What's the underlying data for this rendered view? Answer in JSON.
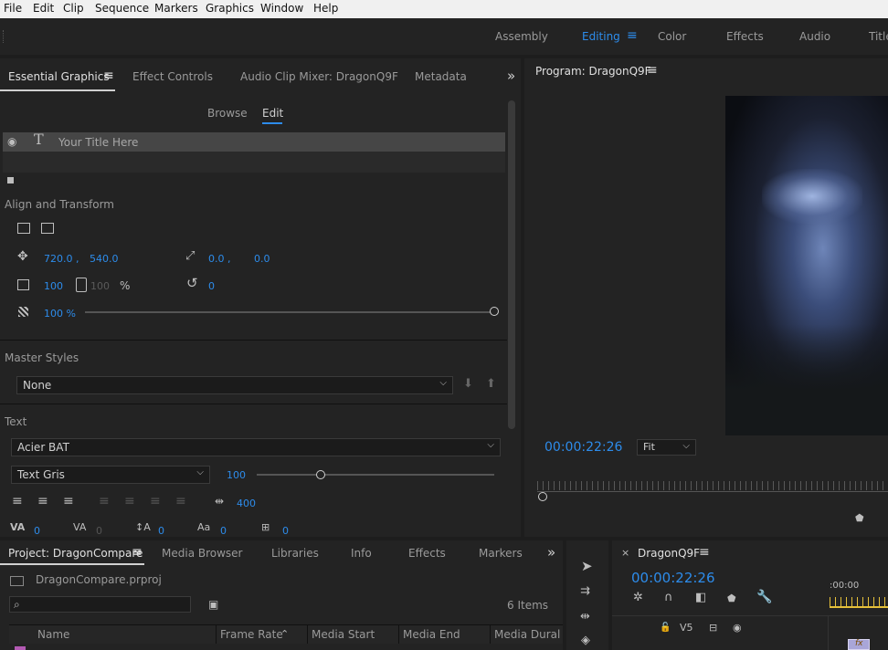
{
  "menu": [
    "File",
    "Edit",
    "Clip",
    "Sequence",
    "Markers",
    "Graphics",
    "Window",
    "Help"
  ],
  "workspaces": {
    "items": [
      "Assembly",
      "Editing",
      "Color",
      "Effects",
      "Audio",
      "Titles"
    ],
    "active": "Editing"
  },
  "left_panel": {
    "tabs": [
      "Essential Graphics",
      "Effect Controls",
      "Audio Clip Mixer: DragonQ9F",
      "Metadata"
    ],
    "subtabs": [
      "Browse",
      "Edit"
    ],
    "layer_name": "Your Title Here",
    "align_section": "Align and Transform",
    "position": {
      "x": "720.0 ,",
      "y": "540.0"
    },
    "anchor": {
      "x": "0.0 ,",
      "y": "0.0"
    },
    "scale": {
      "w": "100",
      "h": "100",
      "unit": "%"
    },
    "rotation": "0",
    "opacity": "100 %",
    "opacity_level": 1.0,
    "master_styles_label": "Master Styles",
    "master_style": "None",
    "text_label": "Text",
    "font": "Acier BAT",
    "font_style": "Text Gris",
    "font_size": "100",
    "font_size_level": 0.27,
    "tracking_alt": "400",
    "kerning": [
      "0",
      "0",
      "0",
      "0",
      "0"
    ]
  },
  "program": {
    "title": "Program: DragonQ9F",
    "timecode": "00:00:22:26",
    "fit": "Fit"
  },
  "project": {
    "tabs": [
      "Project: DragonCompare",
      "Media Browser",
      "Libraries",
      "Info",
      "Effects",
      "Markers"
    ],
    "file": "DragonCompare.prproj",
    "items_count": "6 Items",
    "columns": [
      "Name",
      "Frame Rate",
      "Media Start",
      "Media End",
      "Media Dural"
    ]
  },
  "timeline": {
    "title": "DragonQ9F",
    "timecode": "00:00:22:26",
    "ruler_start": ":00:00",
    "track": "V5"
  },
  "colors": {
    "accent": "#2d8ceb",
    "panel": "#232323",
    "background": "#1d1d1d"
  }
}
